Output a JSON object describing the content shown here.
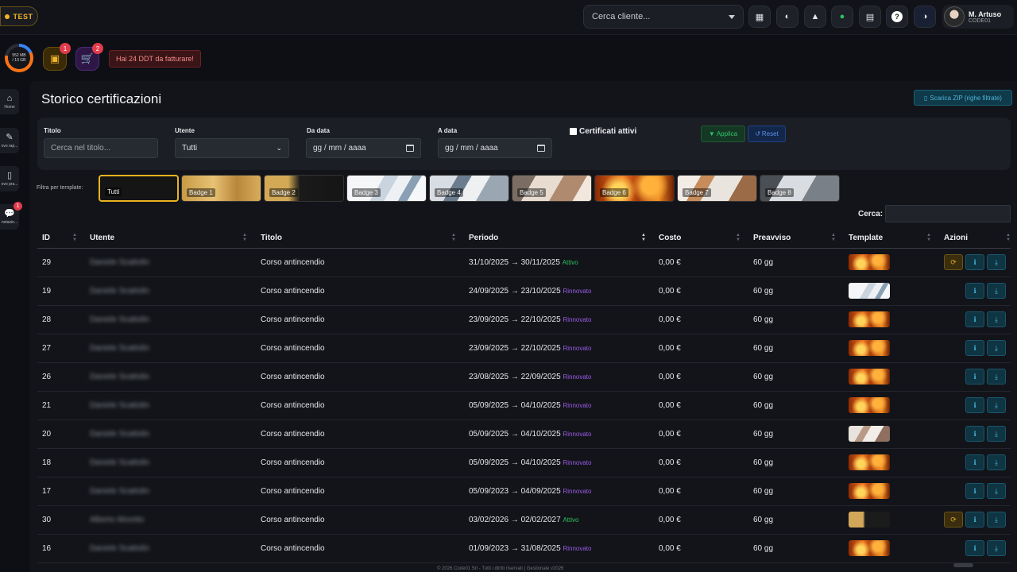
{
  "topbar": {
    "env_badge": "TEST",
    "client_placeholder": "Cerca cliente...",
    "user_name": "M. Artuso",
    "user_code": "CODE01",
    "help_glyph": "?"
  },
  "subbar": {
    "storage_used": "552 MB",
    "storage_total": "/ 10 GB",
    "clipboard_count": "1",
    "cart_count": "2",
    "alert_text": "Hai 24 DDT da fatturare!"
  },
  "sidebar": {
    "items": [
      {
        "label": "Home"
      },
      {
        "label": "ovo rap..."
      },
      {
        "label": "ovo pra..."
      },
      {
        "label": "notazio...",
        "badge": "1"
      }
    ]
  },
  "page": {
    "title": "Storico certificazioni",
    "zip_button": "Scarica ZIP (righe filtrate)"
  },
  "filters": {
    "title_label": "Titolo",
    "title_placeholder": "Cerca nel titolo...",
    "user_label": "Utente",
    "user_value": "Tutti",
    "from_label": "Da data",
    "from_value": "gg / mm / aaaa",
    "to_label": "A data",
    "to_value": "gg / mm / aaaa",
    "active_label": "Certificati attivi",
    "apply_label": "Applica",
    "reset_label": "Reset"
  },
  "templates": {
    "label": "Filtra per template:",
    "chips": [
      "Tutti",
      "Badge 1",
      "Badge 2",
      "Badge 3",
      "Badge 4",
      "Badge 5",
      "Badge 6",
      "Badge 7",
      "Badge 8"
    ]
  },
  "search": {
    "label": "Cerca:"
  },
  "table": {
    "headers": [
      "ID",
      "Utente",
      "Titolo",
      "Periodo",
      "Costo",
      "Preavviso",
      "Template",
      "Azioni"
    ],
    "rows": [
      {
        "id": "29",
        "user": "Daniele Scattolin",
        "title": "Corso antincendio",
        "period": "31/10/2025 → 30/11/2025",
        "status": "Attivo",
        "cost": "0,00 €",
        "notice": "60 gg",
        "thumb": "fire",
        "renew": true
      },
      {
        "id": "19",
        "user": "Daniele Scattolin",
        "title": "Corso antincendio",
        "period": "24/09/2025 → 23/10/2025",
        "status": "Rinnovato",
        "cost": "0,00 €",
        "notice": "60 gg",
        "thumb": "office",
        "renew": false
      },
      {
        "id": "28",
        "user": "Daniele Scattolin",
        "title": "Corso antincendio",
        "period": "23/09/2025 → 22/10/2025",
        "status": "Rinnovato",
        "cost": "0,00 €",
        "notice": "60 gg",
        "thumb": "fire",
        "renew": false
      },
      {
        "id": "27",
        "user": "Daniele Scattolin",
        "title": "Corso antincendio",
        "period": "23/09/2025 → 22/10/2025",
        "status": "Rinnovato",
        "cost": "0,00 €",
        "notice": "60 gg",
        "thumb": "fire",
        "renew": false
      },
      {
        "id": "26",
        "user": "Daniele Scattolin",
        "title": "Corso antincendio",
        "period": "23/08/2025 → 22/09/2025",
        "status": "Rinnovato",
        "cost": "0,00 €",
        "notice": "60 gg",
        "thumb": "fire",
        "renew": false
      },
      {
        "id": "21",
        "user": "Daniele Scattolin",
        "title": "Corso antincendio",
        "period": "05/09/2025 → 04/10/2025",
        "status": "Rinnovato",
        "cost": "0,00 €",
        "notice": "60 gg",
        "thumb": "fire",
        "renew": false
      },
      {
        "id": "20",
        "user": "Daniele Scattolin",
        "title": "Corso antincendio",
        "period": "05/09/2025 → 04/10/2025",
        "status": "Rinnovato",
        "cost": "0,00 €",
        "notice": "60 gg",
        "thumb": "medic",
        "renew": false
      },
      {
        "id": "18",
        "user": "Daniele Scattolin",
        "title": "Corso antincendio",
        "period": "05/09/2025 → 04/10/2025",
        "status": "Rinnovato",
        "cost": "0,00 €",
        "notice": "60 gg",
        "thumb": "fire",
        "renew": false
      },
      {
        "id": "17",
        "user": "Daniele Scattolin",
        "title": "Corso antincendio",
        "period": "05/09/2023 → 04/09/2025",
        "status": "Rinnovato",
        "cost": "0,00 €",
        "notice": "60 gg",
        "thumb": "fire",
        "renew": false
      },
      {
        "id": "30",
        "user": "Alberto Moretto",
        "title": "Corso antincendio",
        "period": "03/02/2026 → 02/02/2027",
        "status": "Attivo",
        "cost": "0,00 €",
        "notice": "60 gg",
        "thumb": "gold",
        "renew": true
      },
      {
        "id": "16",
        "user": "Daniele Scattolin",
        "title": "Corso antincendio",
        "period": "01/09/2023 → 31/08/2025",
        "status": "Rinnovato",
        "cost": "0,00 €",
        "notice": "60 gg",
        "thumb": "fire",
        "renew": false
      }
    ]
  },
  "footer": {
    "text": "© 2026 Code01 Srl - Tutti i diritti riservati | Gestionale v2026"
  },
  "colors": {
    "accent_gold": "#e7b41f",
    "active_green": "#2fbf5f",
    "renewed_purple": "#9b5be6",
    "info_cyan": "#45b0d6"
  }
}
